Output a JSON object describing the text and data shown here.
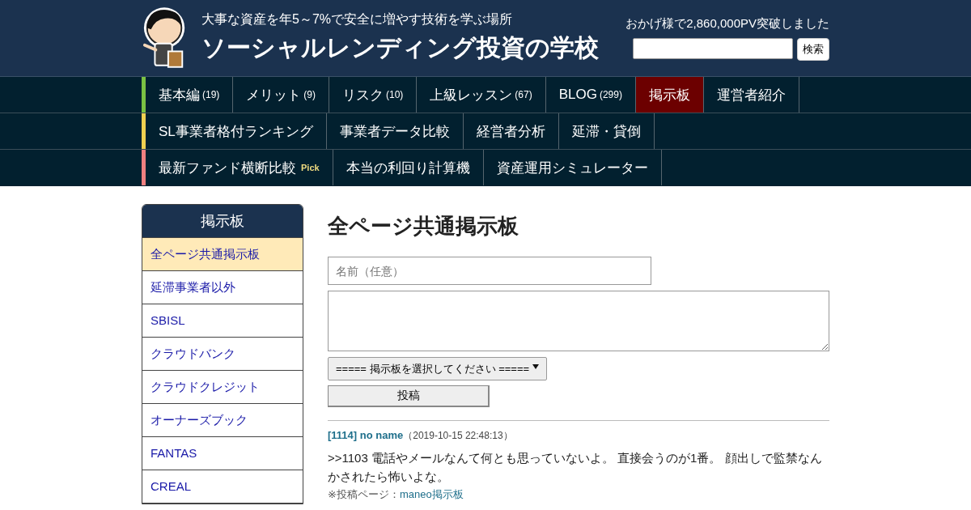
{
  "header": {
    "tagline": "大事な資産を年5～7%で安全に増やす技術を学ぶ場所",
    "title": "ソーシャルレンディング投資の学校",
    "pv_notice": "おかげ様で2,860,000PV突破しました",
    "search": {
      "button": "検索"
    }
  },
  "nav": {
    "rows": [
      {
        "color": "#7ac143",
        "items": [
          {
            "label": "基本編",
            "count": "(19)",
            "selected": false
          },
          {
            "label": "メリット",
            "count": "(9)",
            "selected": false
          },
          {
            "label": "リスク",
            "count": "(10)",
            "selected": false
          },
          {
            "label": "上級レッスン",
            "count": "(67)",
            "selected": false
          },
          {
            "label": "BLOG",
            "count": "(299)",
            "selected": false
          },
          {
            "label": "掲示板",
            "selected": true
          },
          {
            "label": "運営者紹介",
            "selected": false
          }
        ]
      },
      {
        "color": "#f0d050",
        "items": [
          {
            "label": "SL事業者格付ランキング",
            "selected": false
          },
          {
            "label": "事業者データ比較",
            "selected": false
          },
          {
            "label": "経営者分析",
            "selected": false
          },
          {
            "label": "延滞・貸倒",
            "selected": false
          }
        ]
      },
      {
        "color": "#f08080",
        "items": [
          {
            "label": "最新ファンド横断比較",
            "badge": "Pick",
            "selected": false
          },
          {
            "label": "本当の利回り計算機",
            "selected": false
          },
          {
            "label": "資産運用シミュレーター",
            "selected": false
          }
        ]
      }
    ]
  },
  "sidebar": {
    "title": "掲示板",
    "items": [
      {
        "label": "全ページ共通掲示板",
        "selected": true
      },
      {
        "label": "延滞事業者以外",
        "selected": false
      },
      {
        "label": "SBISL",
        "selected": false
      },
      {
        "label": "クラウドバンク",
        "selected": false
      },
      {
        "label": "クラウドクレジット",
        "selected": false
      },
      {
        "label": "オーナーズブック",
        "selected": false
      },
      {
        "label": "FANTAS",
        "selected": false
      },
      {
        "label": "CREAL",
        "selected": false
      }
    ]
  },
  "main": {
    "heading": "全ページ共通掲示板",
    "name_field": {
      "placeholder": "名前（任意）"
    },
    "board_select": {
      "value": "===== 掲示板を選択してください ====="
    },
    "submit": "投稿",
    "posts": [
      {
        "author": "[1114] no name",
        "date": "（2019-10-15 22:48:13）",
        "body": ">>1103 電話やメールなんて何とも思っていないよ。 直接会うのが1番。 顔出しで監禁なんかされたら怖いよな。",
        "source_label": "※投稿ページ：",
        "source_link": "maneo掲示板"
      }
    ]
  }
}
